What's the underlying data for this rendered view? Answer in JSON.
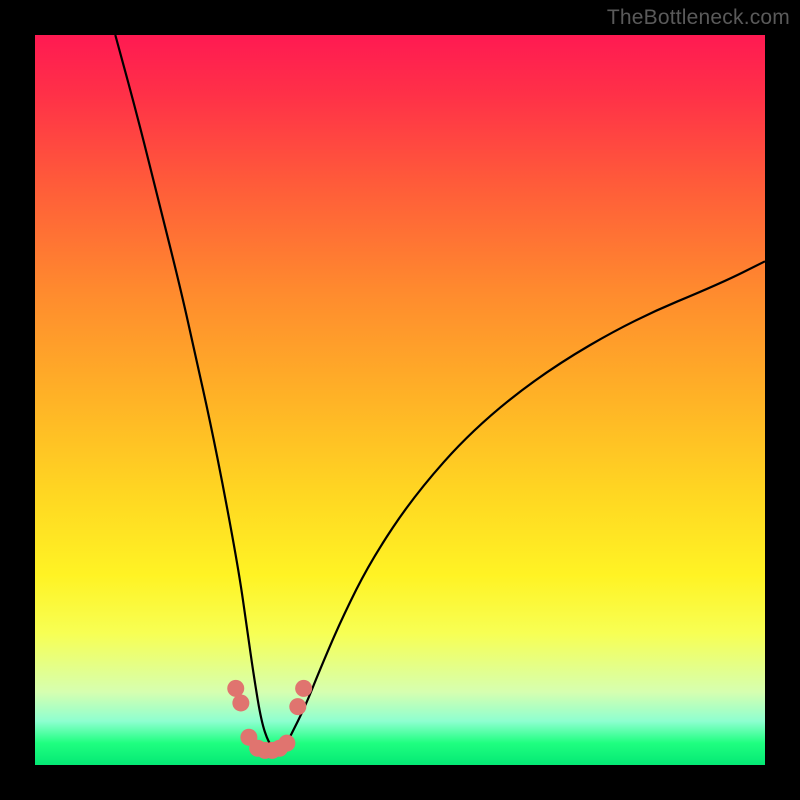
{
  "watermark": "TheBottleneck.com",
  "chart_data": {
    "type": "line",
    "title": "",
    "xlabel": "",
    "ylabel": "",
    "xlim": [
      0,
      100
    ],
    "ylim": [
      0,
      100
    ],
    "grid": false,
    "legend": false,
    "series": [
      {
        "name": "bottleneck-curve",
        "color": "#000000",
        "x": [
          11,
          14,
          17,
          20,
          22,
          24,
          26,
          28,
          29,
          30,
          31,
          32,
          33,
          34,
          35,
          37,
          39,
          42,
          46,
          52,
          60,
          70,
          82,
          94,
          100
        ],
        "y": [
          100,
          89,
          77,
          65,
          56,
          47,
          37,
          26,
          19,
          12,
          6,
          3,
          2,
          2,
          4,
          8,
          13,
          20,
          28,
          37,
          46,
          54,
          61,
          66,
          69
        ]
      },
      {
        "name": "highlight-dots",
        "type": "scatter",
        "color": "#e0746f",
        "x": [
          27.5,
          28.2,
          29.3,
          30.5,
          31.5,
          32.5,
          33.5,
          34.5,
          36.0,
          36.8
        ],
        "y": [
          10.5,
          8.5,
          3.8,
          2.3,
          2.0,
          2.0,
          2.3,
          3.0,
          8.0,
          10.5
        ]
      }
    ],
    "background_gradient": [
      {
        "stop": 0,
        "color": "#ff1a52"
      },
      {
        "stop": 50,
        "color": "#ffb326"
      },
      {
        "stop": 80,
        "color": "#f7ff54"
      },
      {
        "stop": 100,
        "color": "#04e874"
      }
    ]
  }
}
